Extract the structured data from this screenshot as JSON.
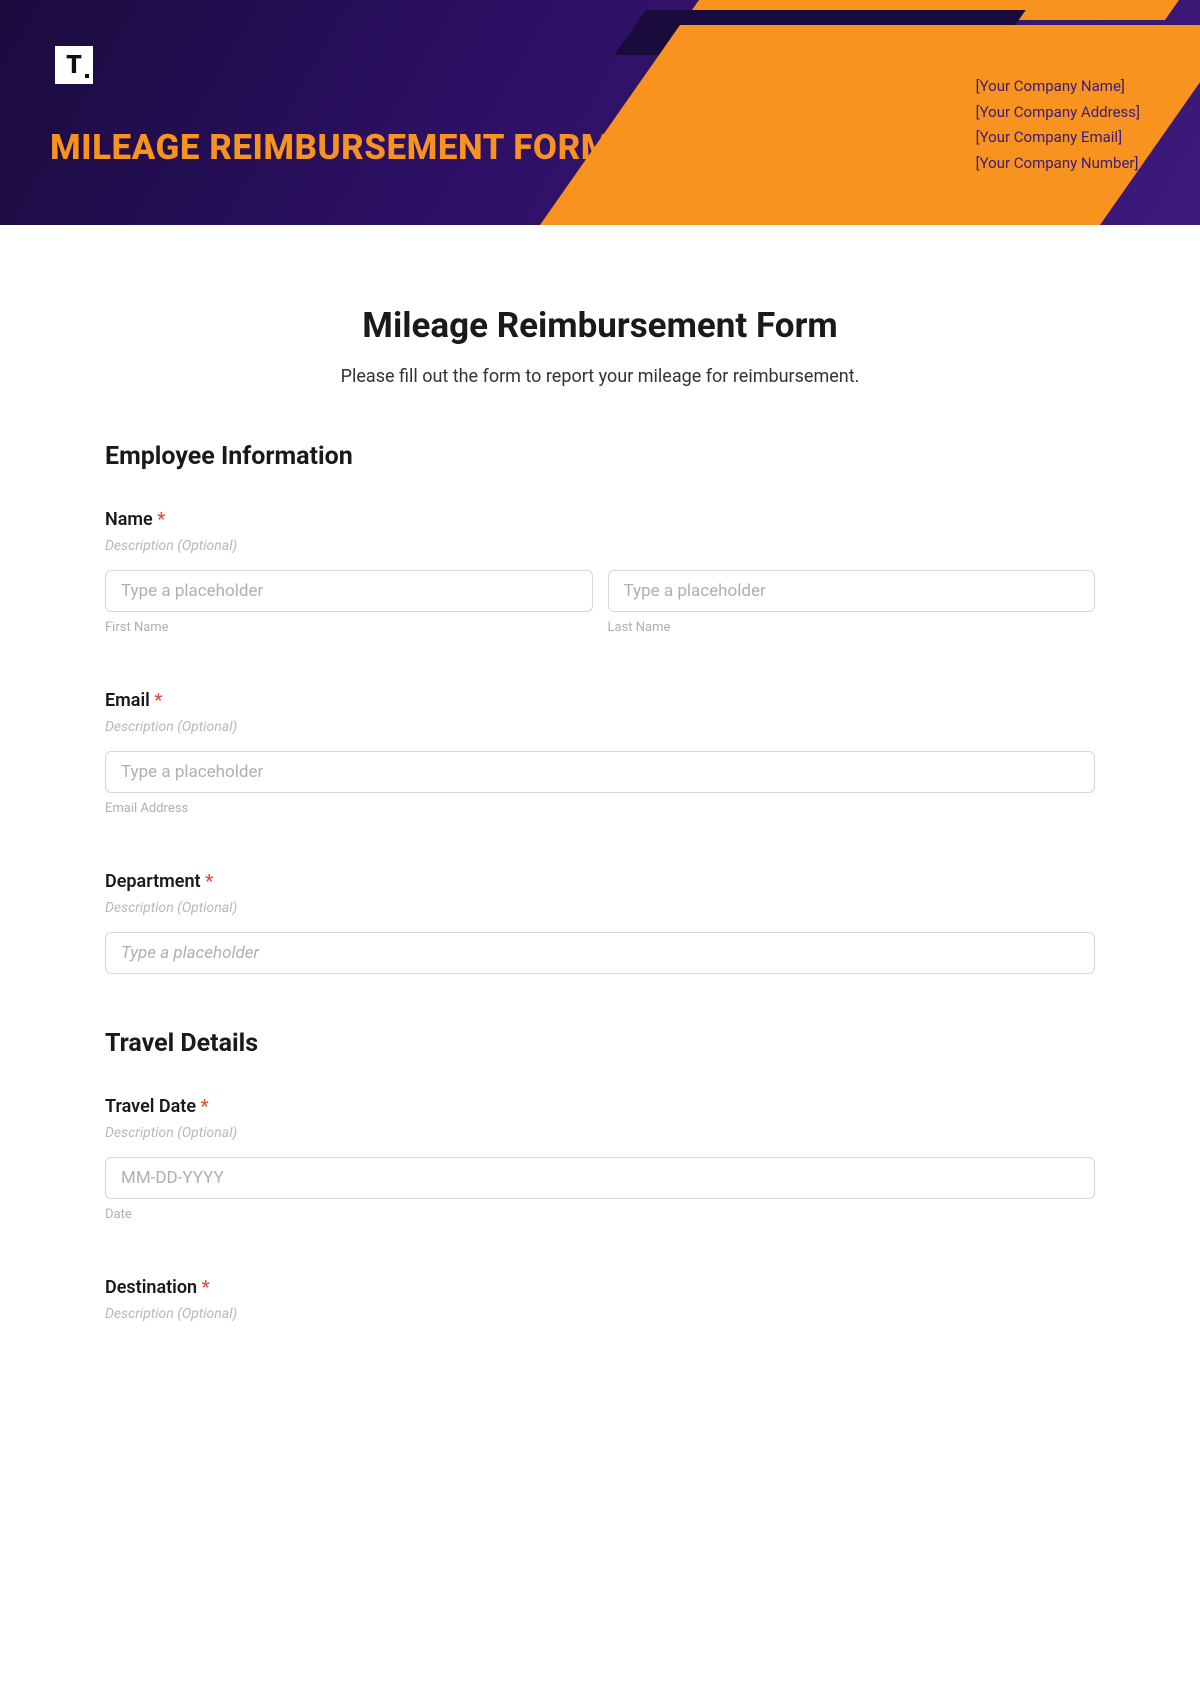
{
  "header": {
    "logo": "T",
    "title": "MILEAGE REIMBURSEMENT FORM",
    "company": {
      "name": "[Your Company Name]",
      "address": "[Your Company Address]",
      "email": "[Your Company Email]",
      "number": "[Your Company Number]"
    }
  },
  "form": {
    "title": "Mileage Reimbursement Form",
    "subtitle": "Please fill out the form to report your mileage for reimbursement.",
    "sections": {
      "employee": {
        "title": "Employee Information"
      },
      "travel": {
        "title": "Travel Details"
      }
    },
    "fields": {
      "name": {
        "label": "Name",
        "required": "*",
        "desc": "Description (Optional)",
        "first_placeholder": "Type a placeholder",
        "first_sub": "First Name",
        "last_placeholder": "Type a placeholder",
        "last_sub": "Last Name"
      },
      "email": {
        "label": "Email",
        "required": "*",
        "desc": "Description (Optional)",
        "placeholder": "Type a placeholder",
        "sub": "Email Address"
      },
      "department": {
        "label": "Department",
        "required": "*",
        "desc": "Description (Optional)",
        "placeholder": "Type a placeholder"
      },
      "travel_date": {
        "label": "Travel Date",
        "required": "*",
        "desc": "Description (Optional)",
        "placeholder": "MM-DD-YYYY",
        "sub": "Date"
      },
      "destination": {
        "label": "Destination",
        "required": "*",
        "desc": "Description (Optional)"
      }
    }
  }
}
